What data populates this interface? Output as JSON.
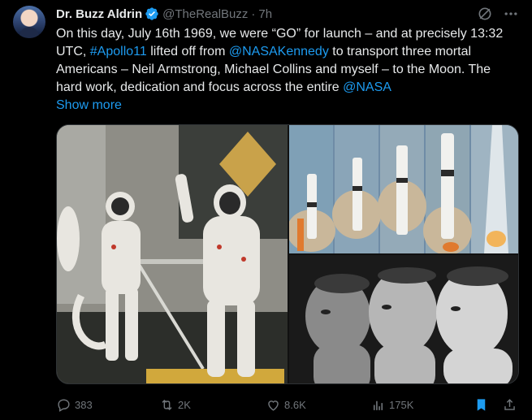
{
  "author": {
    "name": "Dr. Buzz Aldrin",
    "handle": "@TheRealBuzz",
    "separator": "·",
    "time": "7h"
  },
  "tweet": {
    "seg1": "On this day, July 16th 1969, we were “GO” for launch – and at precisely 13:32 UTC, ",
    "link1": "#Apollo11",
    "seg2": " lifted off from ",
    "link2": "@NASAKennedy",
    "seg3": " to transport three mortal Americans – Neil Armstrong, Michael Collins and myself – to the Moon. The hard work, dedication and focus across the entire ",
    "link3": "@NASA",
    "show_more": "Show more"
  },
  "actions": {
    "replies": "383",
    "reposts": "2K",
    "likes": "8.6K",
    "views": "175K"
  },
  "colors": {
    "background": "#000000",
    "text": "#e7e9ea",
    "muted": "#71767b",
    "link": "#1d9bf0",
    "bookmark_active": "#1d9bf0"
  },
  "icons": {
    "verified": "verified-badge-icon",
    "grok": "grok-icon",
    "more": "more-icon",
    "reply": "reply-icon",
    "repost": "repost-icon",
    "like": "like-icon",
    "views": "views-icon",
    "bookmark": "bookmark-icon",
    "share": "share-icon"
  }
}
